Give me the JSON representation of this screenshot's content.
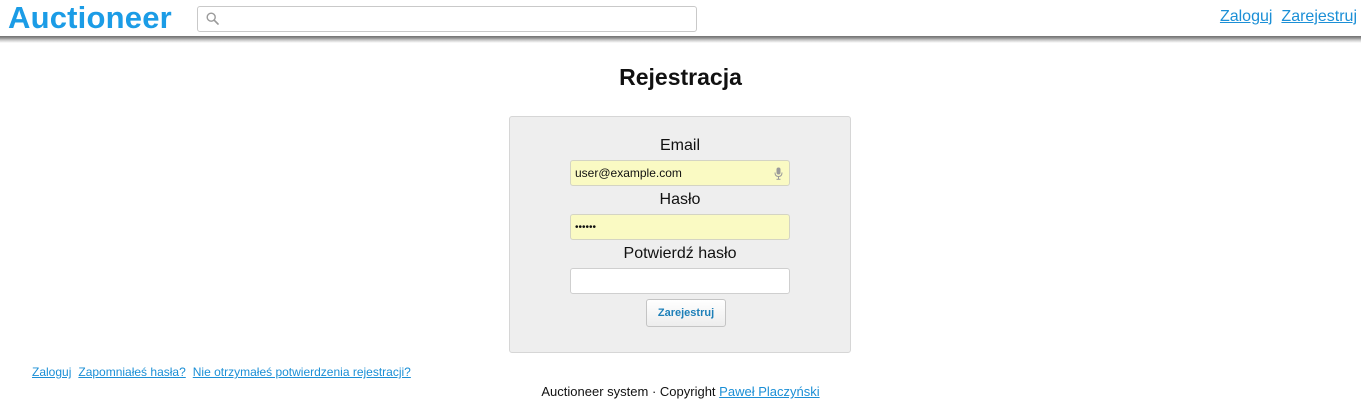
{
  "header": {
    "brand": "Auctioneer",
    "search": {
      "placeholder": "",
      "value": ""
    },
    "nav": {
      "login": "Zaloguj",
      "register": "Zarejestruj"
    }
  },
  "main": {
    "title": "Rejestracja",
    "form": {
      "email_label": "Email",
      "email_value": "user@example.com",
      "password_label": "Hasło",
      "password_value": "••••••",
      "confirm_label": "Potwierdź hasło",
      "confirm_value": "",
      "submit_label": "Zarejestruj"
    }
  },
  "footer": {
    "links": {
      "login": "Zaloguj",
      "forgot": "Zapomniałeś hasła?",
      "resend": "Nie otrzymałeś potwierdzenia rejestracji?"
    },
    "system": "Auctioneer system",
    "separator": "·",
    "copyright_label": "Copyright",
    "author": "Paweł Placzyński"
  },
  "icons": {
    "search": "search-icon",
    "mic": "microphone-icon"
  },
  "colors": {
    "brand": "#1b9ce6",
    "link": "#1b8fd6",
    "autofill": "#fafac3",
    "panel": "#eeeeee"
  }
}
